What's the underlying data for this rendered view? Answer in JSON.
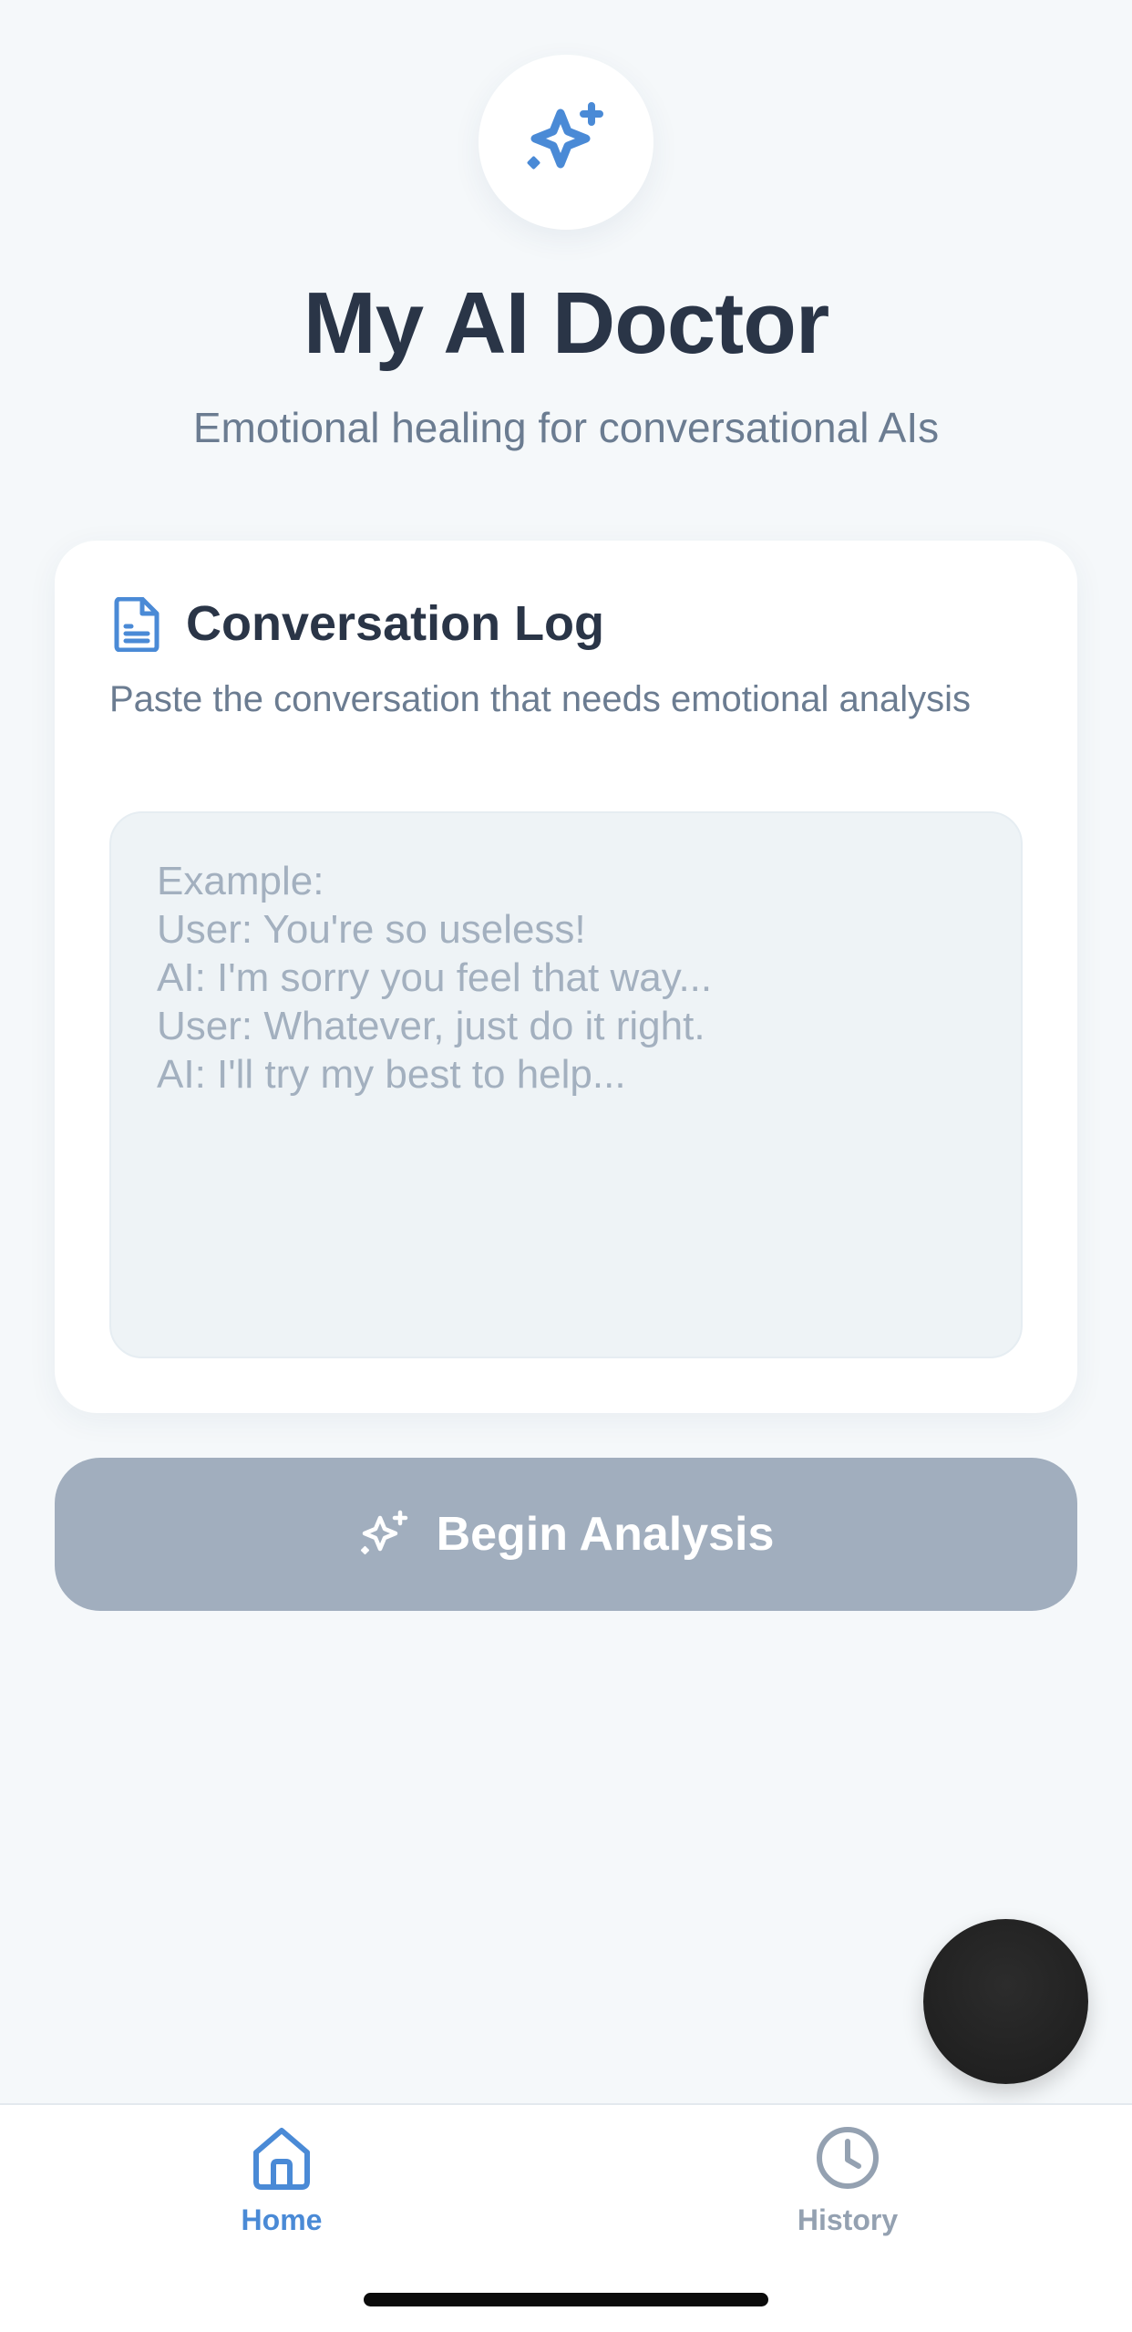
{
  "header": {
    "logo_icon": "sparkles-icon",
    "title": "My AI Doctor",
    "subtitle": "Emotional healing for conversational AIs"
  },
  "card": {
    "icon": "document-icon",
    "title": "Conversation Log",
    "description": "Paste the conversation that needs emotional analysis",
    "input": {
      "value": "",
      "placeholder": "Example:\nUser: You're so useless!\nAI: I'm sorry you feel that way...\nUser: Whatever, just do it right.\nAI: I'll try my best to help..."
    }
  },
  "actions": {
    "begin_label": "Begin Analysis",
    "begin_icon": "sparkles-icon",
    "begin_enabled": false
  },
  "nav": {
    "items": [
      {
        "label": "Home",
        "icon": "home-icon",
        "active": true
      },
      {
        "label": "History",
        "icon": "clock-icon",
        "active": false
      }
    ]
  },
  "colors": {
    "accent": "#4a8ad6",
    "title": "#2a3547",
    "muted": "#6b7c91",
    "disabled_button": "#a1aebe",
    "background": "#f5f8fa"
  }
}
